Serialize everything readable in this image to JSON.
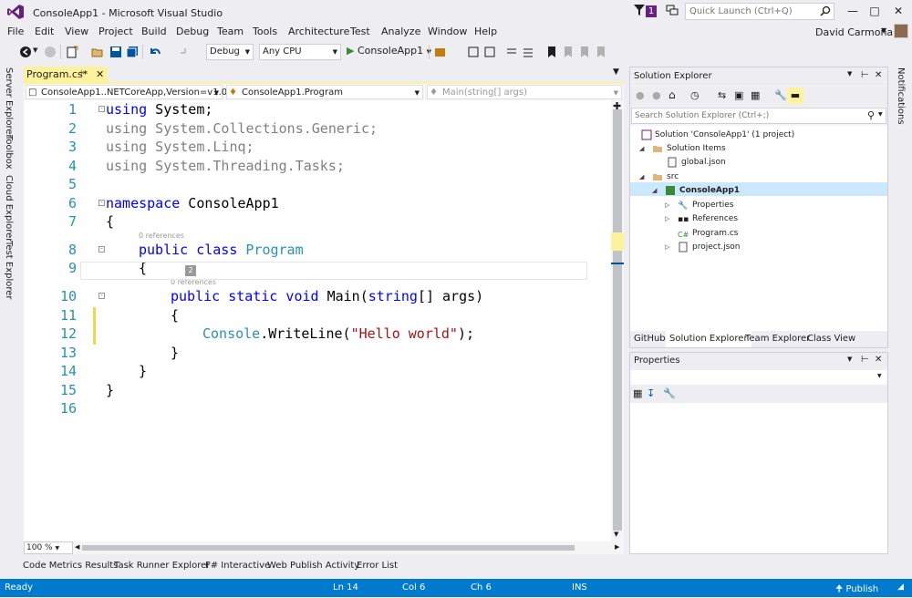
{
  "window": {
    "title": "ConsoleApp1 - Microsoft Visual Studio",
    "notification_count": "1",
    "user": "David Carmona"
  },
  "quick_launch": {
    "placeholder": "Quick Launch (Ctrl+Q)"
  },
  "menu": [
    "File",
    "Edit",
    "View",
    "Project",
    "Build",
    "Debug",
    "Team",
    "Tools",
    "Architecture",
    "Test",
    "Analyze",
    "Window",
    "Help"
  ],
  "toolbar": {
    "config": "Debug",
    "platform": "Any CPU",
    "start_label": "ConsoleApp1"
  },
  "left_tabs": [
    "Server Explorer",
    "Toolbox",
    "Cloud Explorer",
    "Test Explorer"
  ],
  "right_tabs": [
    "Notifications"
  ],
  "document_tab": {
    "label": "Program.cs*"
  },
  "nav": {
    "project": "ConsoleApp1..NETCoreApp,Version=v1.0",
    "type": "ConsoleApp1.Program",
    "member": "Main(string[] args)"
  },
  "editor": {
    "line_numbers": [
      "1",
      "2",
      "3",
      "4",
      "5",
      "6",
      "7",
      "8",
      "9",
      "10",
      "11",
      "12",
      "13",
      "14",
      "15",
      "16"
    ],
    "code": {
      "l1a": "using",
      "l1b": " System;",
      "l2a": "using",
      "l2b": " System.Collections.Generic;",
      "l3a": "using",
      "l3b": " System.Linq;",
      "l4a": "using",
      "l4b": " System.Threading.Tasks;",
      "l6a": "namespace",
      "l6b": " ConsoleApp1",
      "l7": "{",
      "l8a": "public",
      "l8b": " class",
      "l8c": " Program",
      "l9": "{",
      "l10a": "public",
      "l10b": " static",
      "l10c": " void",
      "l10d": " Main(",
      "l10e": "string",
      "l10f": "[] args)",
      "l11": "{",
      "l12a": "Console",
      "l12b": ".WriteLine(",
      "l12c": "\"Hello world\"",
      "l12d": ");",
      "l13": "}",
      "l14": "}",
      "l15": "}"
    },
    "refs_class": "0 references",
    "refs_method": "0 references",
    "tooltip_badge": "2",
    "zoom": "100 %"
  },
  "bottom_tabs": [
    "Code Metrics Results",
    "Task Runner Explorer",
    "F# Interactive",
    "Web Publish Activity",
    "Error List"
  ],
  "status": {
    "ready": "Ready",
    "ln": "Ln 14",
    "col": "Col 6",
    "ch": "Ch 6",
    "mode": "INS",
    "publish": "Publish"
  },
  "solution_explorer": {
    "title": "Solution Explorer",
    "search_placeholder": "Search Solution Explorer (Ctrl+;)",
    "tree": [
      "Solution 'ConsoleApp1' (1 project)",
      "Solution Items",
      "global.json",
      "src",
      "ConsoleApp1",
      "Properties",
      "References",
      "Program.cs",
      "project.json"
    ],
    "tabs": [
      "GitHub",
      "Solution Explorer",
      "Team Explorer",
      "Class View"
    ]
  },
  "properties": {
    "title": "Properties"
  },
  "colors": {
    "accent": "#007acc",
    "vs_purple": "#68217a",
    "tab_yellow": "#fff29d",
    "keyword": "#0000ff",
    "type": "#2b91af",
    "string": "#a31515"
  }
}
